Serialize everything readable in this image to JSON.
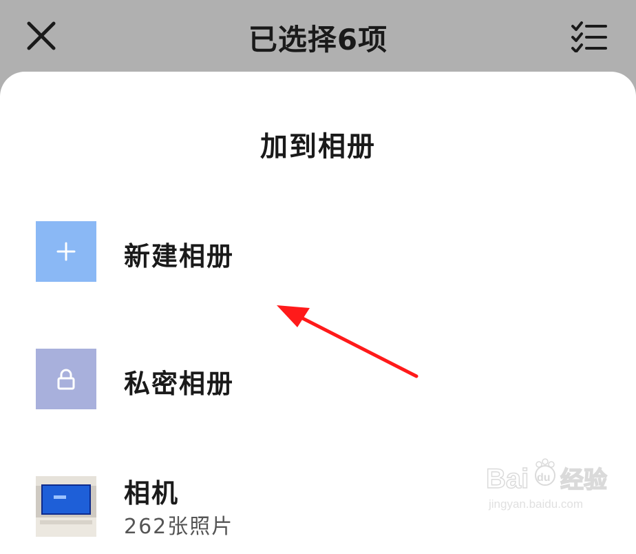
{
  "header": {
    "title": "已选择6项",
    "close_icon": "close-icon",
    "select_all_icon": "checklist-icon"
  },
  "sheet": {
    "title": "加到相册",
    "items": [
      {
        "label": "新建相册",
        "icon": "plus-icon",
        "color": "#8ab8f5"
      },
      {
        "label": "私密相册",
        "icon": "lock-icon",
        "color": "#a8b0dc"
      },
      {
        "label": "相机",
        "subtitle": "262张照片",
        "icon": "album-thumbnail"
      }
    ]
  },
  "watermark": {
    "logo": "Baidu经验",
    "url": "jingyan.baidu.com"
  },
  "annotation": {
    "arrow_color": "#ff1a1a"
  }
}
